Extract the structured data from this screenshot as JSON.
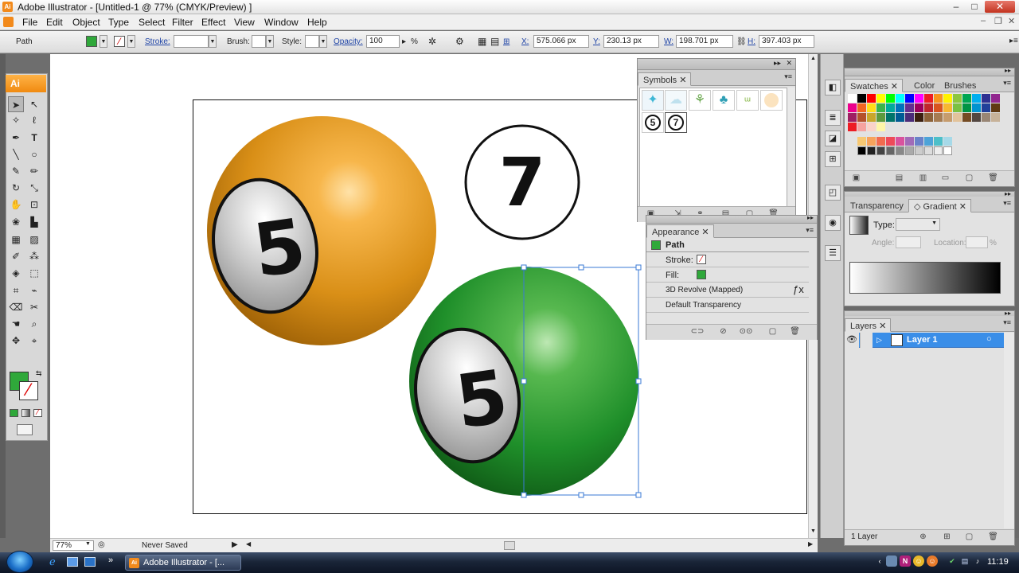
{
  "titlebar": {
    "title": "Adobe Illustrator - [Untitled-1 @ 77% (CMYK/Preview) ]"
  },
  "menu": [
    "File",
    "Edit",
    "Object",
    "Type",
    "Select",
    "Filter",
    "Effect",
    "View",
    "Window",
    "Help"
  ],
  "control": {
    "selection": "Path",
    "stroke_label": "Stroke:",
    "brush_label": "Brush:",
    "style_label": "Style:",
    "opacity_label": "Opacity:",
    "opacity_value": "100",
    "opacity_unit": "%",
    "x_label": "X:",
    "x_value": "575.066 px",
    "y_label": "Y:",
    "y_value": "230.13 px",
    "w_label": "W:",
    "w_value": "198.701 px",
    "h_label": "H:",
    "h_value": "397.403 px"
  },
  "toolbox": {
    "badge": "Ai"
  },
  "canvas": {
    "ball_orange_number": "5",
    "ball_seven_number": "7",
    "ball_green_number": "5",
    "colors": {
      "orange": "#d98f17",
      "green": "#1f8f2a",
      "white_ball": "#c8c8c8"
    }
  },
  "symbols": {
    "tab": "Symbols",
    "numbers": [
      "5",
      "7"
    ]
  },
  "appearance": {
    "tab": "Appearance",
    "object": "Path",
    "stroke_label": "Stroke:",
    "fill_label": "Fill:",
    "effect": "3D Revolve (Mapped)",
    "transparency": "Default Transparency"
  },
  "swatches": {
    "tabs": [
      "Swatches",
      "Color",
      "Brushes"
    ]
  },
  "gradient": {
    "tabs": [
      "Transparency",
      "Gradient"
    ],
    "type_label": "Type:",
    "angle_label": "Angle:",
    "location_label": "Location:",
    "percent": "%"
  },
  "layers": {
    "tab": "Layers",
    "layer_name": "Layer 1",
    "count": "1 Layer"
  },
  "status": {
    "zoom": "77%",
    "state": "Never Saved"
  },
  "taskbar": {
    "app": "Adobe Illustrator - [...",
    "time": "11:19"
  }
}
